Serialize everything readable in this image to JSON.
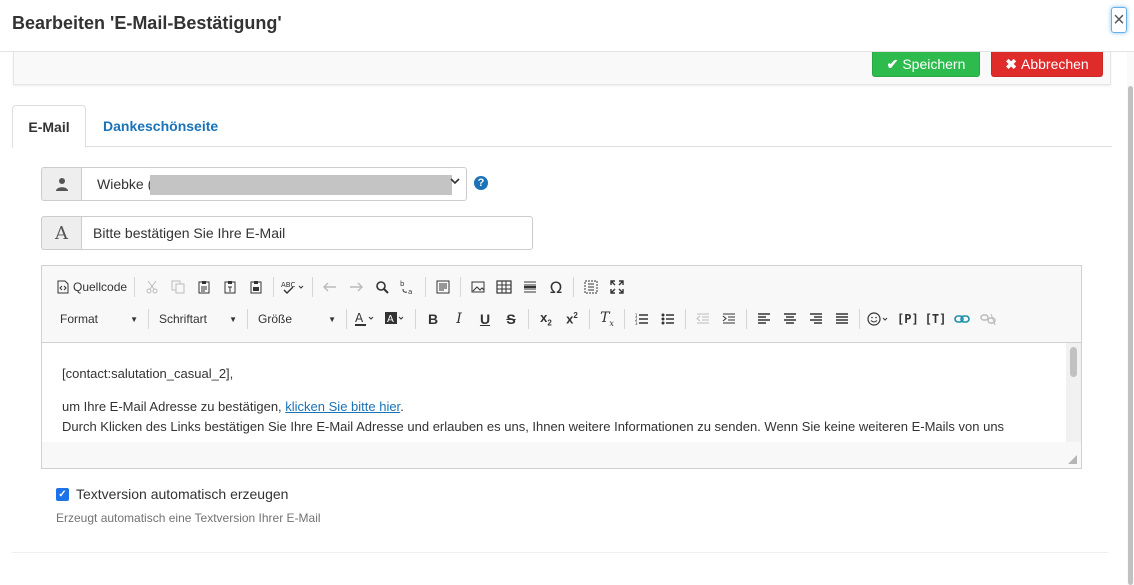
{
  "modal": {
    "title": "Bearbeiten 'E-Mail-Bestätigung'",
    "close_glyph": "×"
  },
  "actions": {
    "save_label": "Speichern",
    "save_icon": "check-icon",
    "save_color": "#2dbb4d",
    "cancel_label": "Abbrechen",
    "cancel_icon": "x-icon",
    "cancel_color": "#e02b2b"
  },
  "tabs": [
    {
      "label": "E-Mail",
      "active": true
    },
    {
      "label": "Dankeschönseite",
      "active": false
    }
  ],
  "sender": {
    "value": "Wiebke (",
    "icon": "user-icon"
  },
  "subject": {
    "value": "Bitte bestätigen Sie Ihre E-Mail",
    "icon": "font-a-icon"
  },
  "editor": {
    "toolbar": {
      "source_label": "Quellcode",
      "format_label": "Format",
      "font_label": "Schriftart",
      "size_label": "Größe"
    },
    "content": {
      "line1": "[contact:salutation_casual_2],",
      "line2_prefix": "um Ihre E-Mail Adresse zu bestätigen, ",
      "line2_link": "klicken Sie bitte hier",
      "line2_suffix": ".",
      "line3": "Durch Klicken des Links bestätigen Sie Ihre E-Mail Adresse und erlauben es uns, Ihnen weitere Informationen zu senden. Wenn Sie keine weiteren E-Mails von uns"
    }
  },
  "text_version": {
    "checked": true,
    "label": "Textversion automatisch erzeugen",
    "help": "Erzeugt automatisch eine Textversion Ihrer E-Mail"
  },
  "colors": {
    "accent": "#1a73b8",
    "checkbox": "#1a73e8"
  }
}
